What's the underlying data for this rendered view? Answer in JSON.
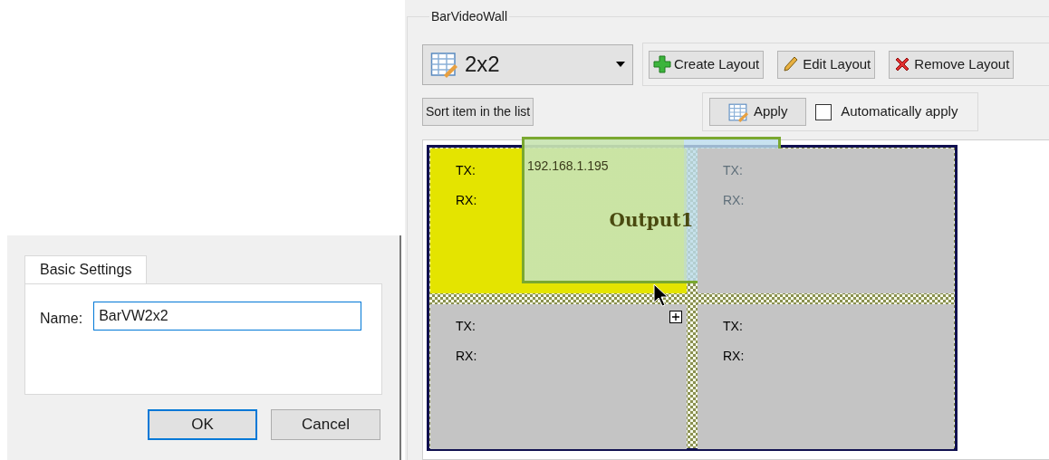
{
  "dialog": {
    "tabs": [
      {
        "label": "Basic Settings",
        "selected": true
      }
    ],
    "name_label": "Name:",
    "name_value": "BarVW2x2",
    "buttons": [
      {
        "label": "OK",
        "default": true
      },
      {
        "label": "Cancel",
        "default": false
      }
    ]
  },
  "video_wall": {
    "title": "BarVideoWall",
    "layout_select": {
      "value": "2x2"
    },
    "toolbar": [
      {
        "label": "Create Layout",
        "kind": "create"
      },
      {
        "label": "Edit Layout",
        "kind": "edit"
      },
      {
        "label": "Remove Layout",
        "kind": "remove"
      }
    ],
    "sort_button": "Sort item in the list",
    "apply_button": "Apply",
    "auto_apply": {
      "label": "Automatically apply",
      "checked": false
    },
    "cells": [
      {
        "tx": "TX:",
        "rx": "RX:",
        "selected": true
      },
      {
        "tx": "TX:",
        "rx": "RX:",
        "selected": false
      },
      {
        "tx": "TX:",
        "rx": "RX:",
        "selected": false
      },
      {
        "tx": "TX:",
        "rx": "RX:",
        "selected": false
      }
    ],
    "output": {
      "ip": "192.168.1.195",
      "title": "Output1"
    }
  }
}
